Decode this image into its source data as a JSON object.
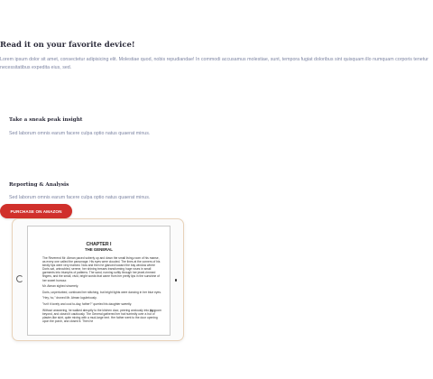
{
  "headline": "Read it on your favorite device!",
  "intro": "Lorem ipsum dolor sit amet, consectetur adipisicing elit. Molestiae quod, nobis repudiandae! In commodi accusamus molestiae, sunt, tempora fugiat doloribus sint quisquam illo numquam corporis tenetur necessitatibus expedita eius, sed.",
  "features": [
    {
      "title": "Take a sneak peak insight",
      "text": "Sed laborum omnis earum facere culpa optio natus quaerat minus."
    },
    {
      "title": "Reporting & Analysis",
      "text": "Sed laborum omnis earum facere culpa optio natus quaerat minus."
    }
  ],
  "purchase_button": "PURCHASE ON AMAZON",
  "book": {
    "chapter": "CHAPTER I",
    "chapter_title": "THE GENERAL",
    "paragraphs": [
      "The Reverend Mr. Atman paced soberly up and down the small living-room of his manse, as every one called the parsonage. His eyes were clouded. The lines at the corners of his kindly lips were very marked. Now and then he glanced toward the bay window where Doris sat, untroubled, serene, her shining tresses transforming huge roses in small garments into triumphs of patterns. The sand, running softly through her jewel-rimmed fingers, and the small, vivid, bright words that came from her pretty lips in the sunshine of her sweet humour.",
      "Mr. Atman sighed sincerely.",
      "Doris, unperturbed, continued her stitching, but bright lights were dancing in her blue eyes.",
      "\"Hey, ho,\" droned Mr. Atman lugubriously.",
      "\"Isn't it lovely and cool to-day, father?\" queried his daughter sweetly.",
      "Without answering, he walked abruptly to the kitchen door, peering anxiously into the room beyond, and closed it cautiously. The General gathered her hat hurriedly over a hut of plaster-like skirt, quite mixing with a mud-large tent. Her father went to the door opening upon the porch, and closed it. Then he"
    ],
    "page_number": "Pk 5"
  }
}
